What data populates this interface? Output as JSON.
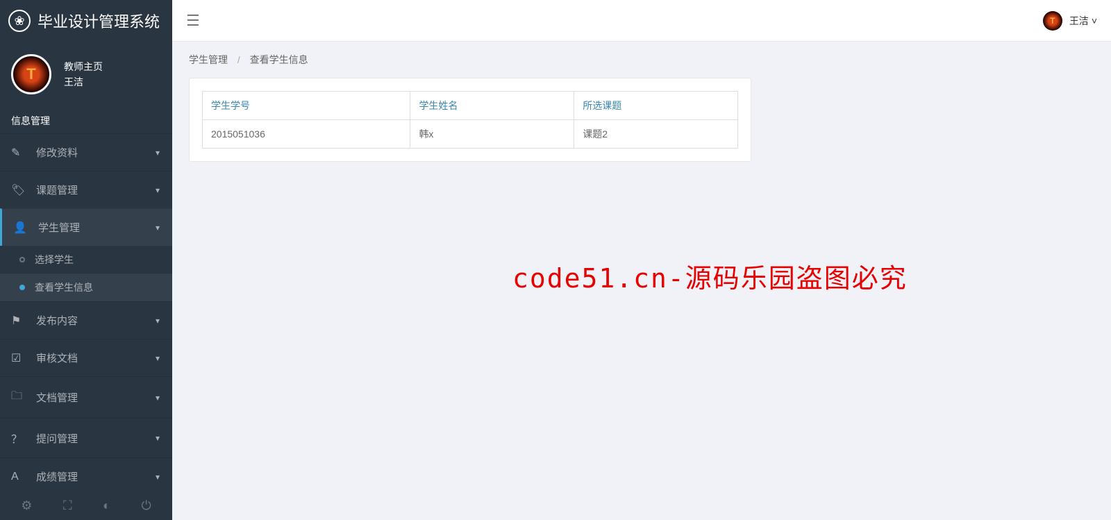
{
  "brand": {
    "title": "毕业设计管理系统",
    "icon_text": "❀"
  },
  "profile": {
    "role": "教师主页",
    "name": "王洁",
    "avatar_letter": "T"
  },
  "section": "信息管理",
  "nav": [
    {
      "icon": "✎",
      "label": "修改资料"
    },
    {
      "icon": "🏷",
      "label": "课题管理"
    },
    {
      "icon": "👤",
      "label": "学生管理",
      "active": true
    },
    {
      "icon": "⚑",
      "label": "发布内容"
    },
    {
      "icon": "☑",
      "label": "审核文档"
    },
    {
      "icon": "🗀",
      "label": "文档管理"
    },
    {
      "icon": "？",
      "label": "提问管理"
    },
    {
      "icon": "A",
      "label": "成绩管理"
    }
  ],
  "sub": [
    {
      "label": "选择学生"
    },
    {
      "label": "查看学生信息",
      "active": true
    }
  ],
  "bottom_icons": {
    "gear": "⚙",
    "fullscreen": "⛶",
    "power_brightness": "◐",
    "power": "⏻"
  },
  "topbar": {
    "user_name": "王洁",
    "caret": "˅"
  },
  "breadcrumb": {
    "a": "学生管理",
    "b": "查看学生信息"
  },
  "table": {
    "headers": [
      "学生学号",
      "学生姓名",
      "所选课题"
    ],
    "rows": [
      [
        "2015051036",
        "韩x",
        "课题2"
      ]
    ]
  },
  "watermark": "code51.cn-源码乐园盗图必究"
}
